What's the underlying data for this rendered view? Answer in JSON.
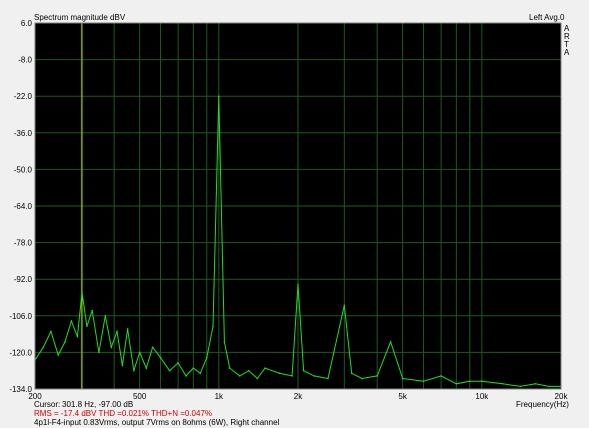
{
  "header": {
    "title": "Spectrum magnitude dBV",
    "mode": "Left  Avg.0",
    "brand_letters": [
      "A",
      "R",
      "T",
      "A"
    ]
  },
  "status": {
    "cursor_label": "Cursor:",
    "cursor_value": "301.8 Hz, -97.00 dB",
    "rms_line": "RMS =  -17.4 dBV   THD =0.021%   THD+N =0.047%",
    "description": "4p1l-F4-input 0.83Vrms, output 7Vrms on 8ohms (6W), Right channel"
  },
  "colors": {
    "plot_bg": "#000000",
    "grid": "#1f5a1f",
    "trace": "#22dd22",
    "cursor": "#c8c800",
    "accent_text": "#cc0000"
  },
  "chart_data": {
    "type": "line",
    "title": "Spectrum magnitude dBV",
    "xlabel": "Frequency(Hz)",
    "ylabel": "",
    "x_scale": "log",
    "xlim": [
      200,
      20000
    ],
    "ylim": [
      -134,
      6
    ],
    "grid": true,
    "y_ticks": [
      "6.0",
      "-8.0",
      "-22.0",
      "-36.0",
      "-50.0",
      "-64.0",
      "-78.0",
      "-92.0",
      "-106.0",
      "-120.0",
      "-134.0"
    ],
    "x_ticks": [
      "200",
      "500",
      "1k",
      "2k",
      "5k",
      "10k",
      "20k"
    ],
    "cursor": {
      "x": 301.8,
      "y": -97.0
    },
    "series": [
      {
        "name": "",
        "x": [
          200,
          215,
          230,
          245,
          260,
          275,
          290,
          301.8,
          315,
          330,
          350,
          370,
          390,
          410,
          430,
          450,
          475,
          500,
          530,
          560,
          600,
          650,
          700,
          750,
          800,
          850,
          900,
          950,
          1000,
          1050,
          1100,
          1200,
          1300,
          1400,
          1500,
          1700,
          1900,
          2000,
          2100,
          2300,
          2600,
          3000,
          3200,
          3500,
          4000,
          4500,
          5000,
          6000,
          7000,
          8000,
          9000,
          10000,
          12000,
          14000,
          16000,
          18000,
          20000
        ],
        "y": [
          -123,
          -118,
          -112,
          -121,
          -116,
          -108,
          -114,
          -97,
          -110,
          -104,
          -120,
          -106,
          -118,
          -112,
          -125,
          -111,
          -127,
          -120,
          -126,
          -118,
          -122,
          -127,
          -124,
          -129,
          -126,
          -128,
          -122,
          -110,
          -22,
          -116,
          -126,
          -129,
          -127,
          -130,
          -126,
          -128,
          -129,
          -94,
          -127,
          -129,
          -130,
          -102,
          -128,
          -130,
          -129,
          -116,
          -130,
          -131,
          -129,
          -132,
          -131,
          -131,
          -132,
          -133,
          -132,
          -133,
          -133
        ]
      }
    ]
  }
}
